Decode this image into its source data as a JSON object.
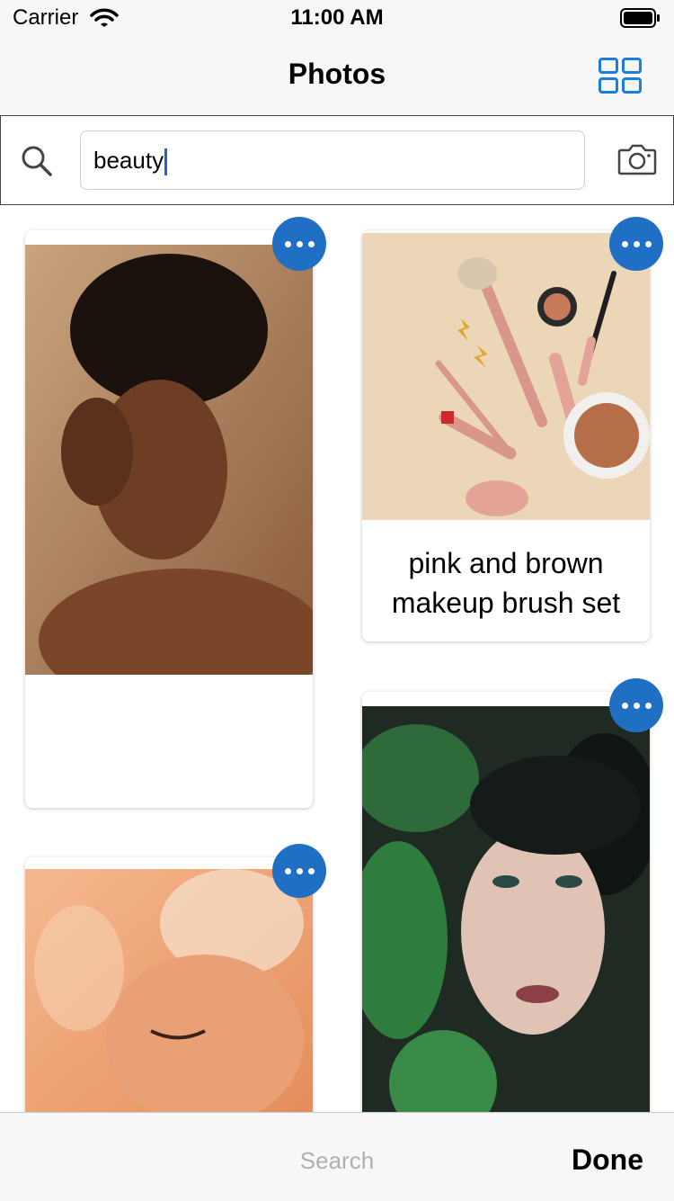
{
  "status": {
    "carrier": "Carrier",
    "time": "11:00 AM"
  },
  "nav": {
    "title": "Photos"
  },
  "search": {
    "value": "beauty"
  },
  "cards": [
    {
      "caption": ""
    },
    {
      "caption_line1": "pink and brown",
      "caption_line2": "makeup brush set"
    },
    {
      "caption": ""
    },
    {
      "caption": ""
    }
  ],
  "toolbar": {
    "search_label": "Search",
    "done_label": "Done"
  },
  "colors": {
    "accent": "#1f6fc4",
    "grid_icon": "#1a7ee0",
    "caret": "#1f5fd6"
  }
}
